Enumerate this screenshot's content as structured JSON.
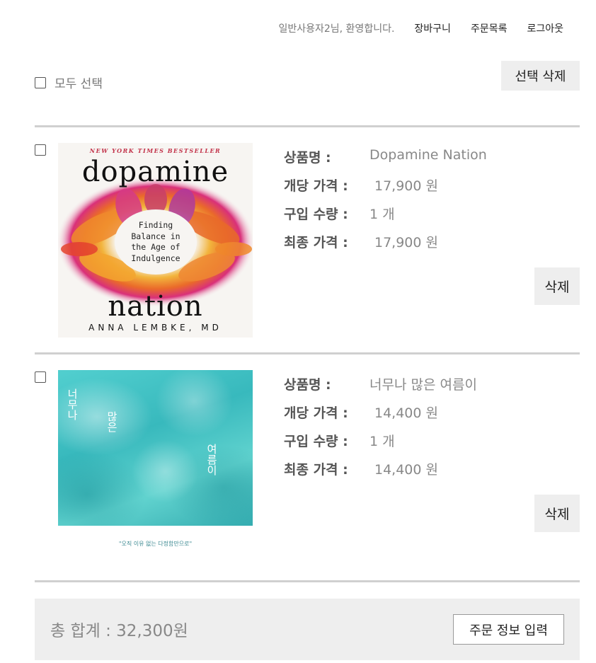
{
  "header": {
    "welcome": "일반사용자2님, 환영합니다.",
    "cart_link": "장바구니",
    "orders_link": "주문목록",
    "logout_link": "로그아웃"
  },
  "toolbar": {
    "select_all_label": "모두 선택",
    "delete_selected_label": "선택 삭제"
  },
  "labels": {
    "name": "상품명 :",
    "unit_price": "개당 가격 :",
    "quantity": "구입 수량 :",
    "final_price": "최종 가격 :",
    "delete": "삭제"
  },
  "items": [
    {
      "name": "Dopamine Nation",
      "unit_price": "17,900 원",
      "quantity": "1 개",
      "final_price": "17,900 원",
      "cover": {
        "banner": "NEW YORK TIMES BESTSELLER",
        "title_top": "dopamine",
        "title_bottom": "nation",
        "tagline_lines": [
          "Finding",
          "Balance in",
          "the Age of",
          "Indulgence"
        ],
        "author": "ANNA LEMBKE, MD"
      }
    },
    {
      "name": "너무나 많은 여름이",
      "unit_price": "14,400 원",
      "quantity": "1 개",
      "final_price": "14,400 원",
      "cover": {
        "title_a": "너무나",
        "title_b": "많은",
        "title_c": "여름이",
        "quote": "\"오직 이유 없는 다정함만으로\""
      }
    }
  ],
  "summary": {
    "total": "총 합계 : 32,300원",
    "order_button": "주문 정보 입력"
  },
  "colors": {
    "button_bg": "#eeeeee",
    "divider": "#d0d0d0",
    "label_text": "#555555",
    "value_text": "#888888"
  }
}
